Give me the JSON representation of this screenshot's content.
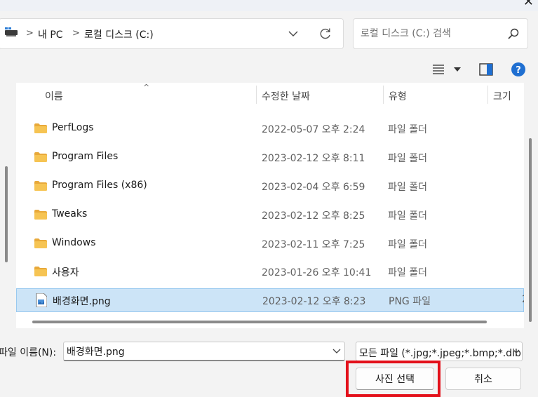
{
  "address": {
    "crumbs": [
      "내 PC",
      "로컬 디스크 (C:)"
    ]
  },
  "search": {
    "placeholder": "로컬 디스크 (C:) 검색"
  },
  "columns": {
    "name": "이름",
    "modified": "수정한 날짜",
    "type": "유형",
    "size": "크기"
  },
  "files": [
    {
      "name": "PerfLogs",
      "modified": "2022-05-07 오후 2:24",
      "type": "파일 폴더",
      "size": "",
      "kind": "folder"
    },
    {
      "name": "Program Files",
      "modified": "2023-02-12 오후 8:11",
      "type": "파일 폴더",
      "size": "",
      "kind": "folder"
    },
    {
      "name": "Program Files (x86)",
      "modified": "2023-02-04 오후 6:59",
      "type": "파일 폴더",
      "size": "",
      "kind": "folder"
    },
    {
      "name": "Tweaks",
      "modified": "2023-02-12 오후 8:25",
      "type": "파일 폴더",
      "size": "",
      "kind": "folder"
    },
    {
      "name": "Windows",
      "modified": "2023-02-11 오후 7:25",
      "type": "파일 폴더",
      "size": "",
      "kind": "folder"
    },
    {
      "name": "사용자",
      "modified": "2023-01-26 오후 10:41",
      "type": "파일 폴더",
      "size": "",
      "kind": "folder"
    },
    {
      "name": "배경화면.png",
      "modified": "2023-02-12 오후 8:23",
      "type": "PNG 파일",
      "size": "2",
      "kind": "png",
      "selected": true
    }
  ],
  "bottom": {
    "filename_label": "파일 이름(N):",
    "filename_value": "배경화면.png",
    "filetype_value": "모든 파일 (*.jpg;*.jpeg;*.bmp;*.dib",
    "select_button": "사진 선택",
    "cancel_button": "취소"
  },
  "icons": {
    "close": "close-icon",
    "pc": "pc-icon",
    "refresh": "refresh-icon",
    "search": "search-icon",
    "view": "view-list-icon",
    "preview_pane": "preview-pane-icon",
    "help": "help-icon",
    "folder": "folder-icon",
    "png": "png-file-icon"
  },
  "colors": {
    "selection": "#cce4f7",
    "selection_border": "#99c9ef",
    "highlight": "#e3101a",
    "folder": "#f4c14d",
    "help": "#1f6fd1"
  }
}
